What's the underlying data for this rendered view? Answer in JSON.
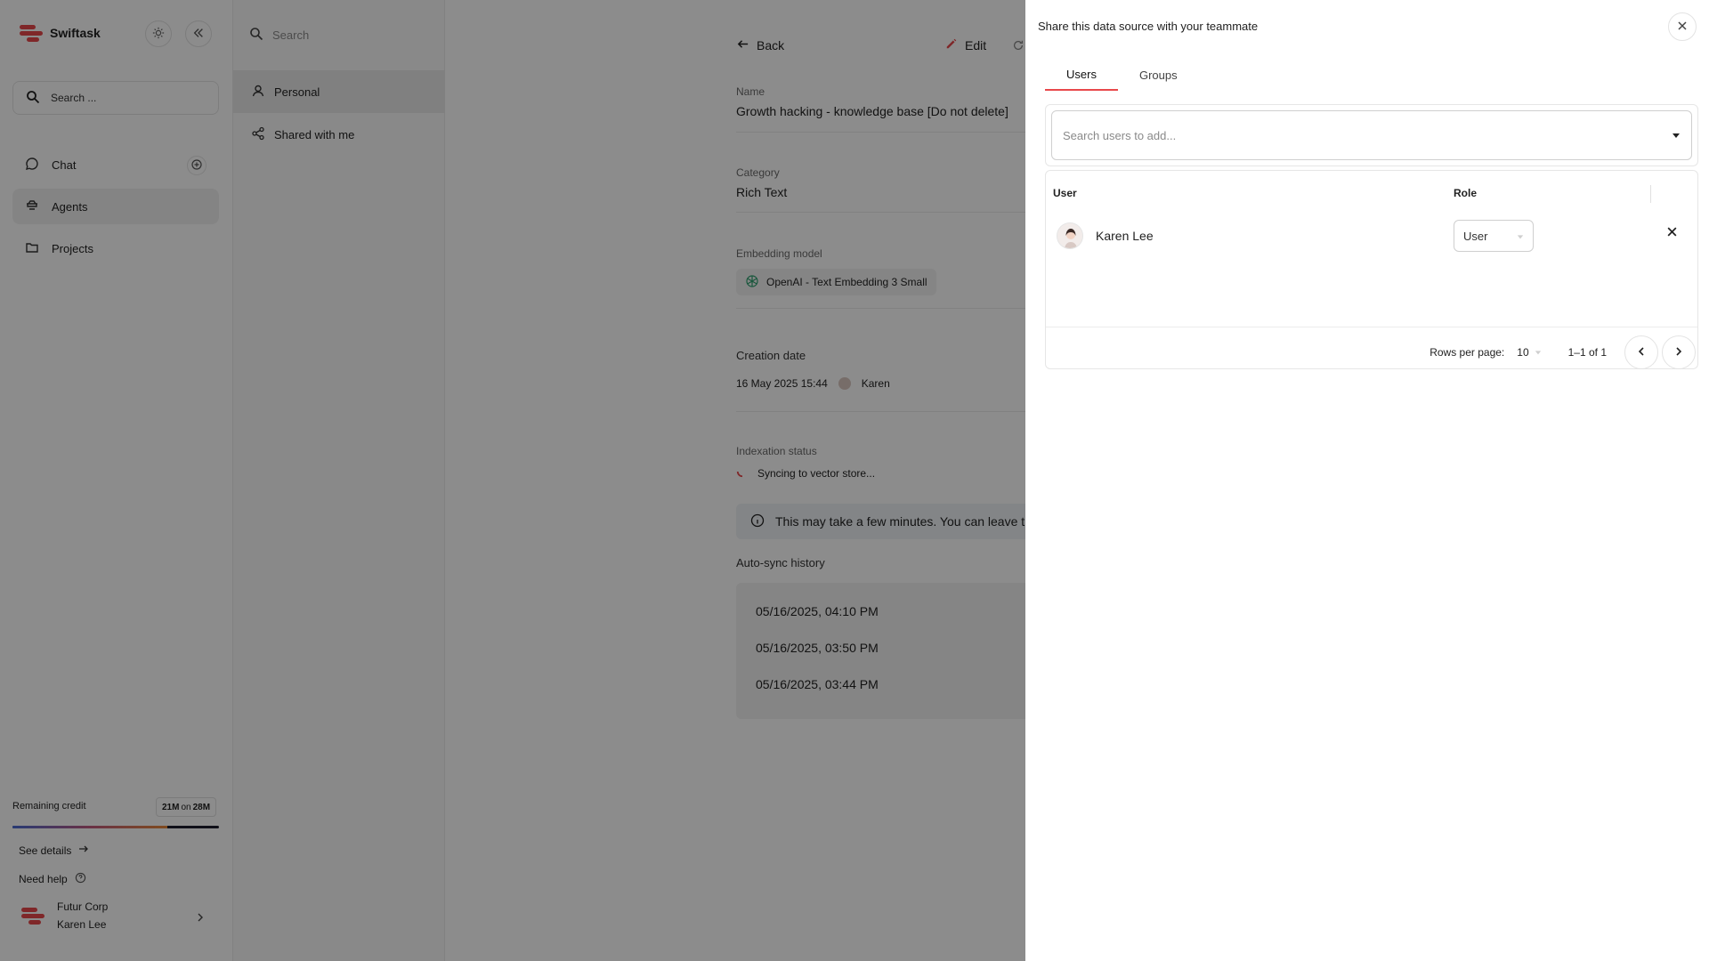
{
  "app": {
    "brand_name": "Swiftask",
    "brand_color": "#e8484b"
  },
  "sidebar": {
    "search_label": "Search ...",
    "nav": [
      {
        "label": "Chat",
        "icon": "chat-bubble-icon"
      },
      {
        "label": "Agents",
        "icon": "agents-icon"
      },
      {
        "label": "Projects",
        "icon": "folder-icon"
      }
    ],
    "credit": {
      "label": "Remaining credit",
      "remaining": "21M",
      "on": "on",
      "total": "28M",
      "used_fraction": 0.75
    },
    "see_details": "See details",
    "need_help": "Need help",
    "org_name": "Futur Corp",
    "user_name": "Karen Lee"
  },
  "column2": {
    "search_placeholder": "Search",
    "items": [
      {
        "label": "Personal",
        "icon": "person-icon"
      },
      {
        "label": "Shared with me",
        "icon": "share-icon"
      }
    ]
  },
  "main": {
    "back_label": "Back",
    "edit_label": "Edit",
    "name_label": "Name",
    "name_value": "Growth hacking - knowledge base [Do not delete]",
    "category_label": "Category",
    "category_value": "Rich Text",
    "embedding_label": "Embedding model",
    "embedding_value": "OpenAI - Text Embedding 3 Small",
    "creation_label": "Creation date",
    "creation_date": "16 May 2025 15:44",
    "creator": "Karen",
    "indexation_label": "Indexation status",
    "indexation_value": "Syncing to vector store...",
    "info_text": "This may take a few minutes. You can leave this",
    "history_label": "Auto-sync history",
    "history": [
      "05/16/2025, 04:10 PM",
      "05/16/2025, 03:50 PM",
      "05/16/2025, 03:44 PM"
    ]
  },
  "drawer": {
    "title": "Share this data source with your teammate",
    "tabs": [
      "Users",
      "Groups"
    ],
    "search_placeholder": "Search users to add...",
    "columns": {
      "user": "User",
      "role": "Role"
    },
    "rows": [
      {
        "name": "Karen Lee",
        "role": "User"
      }
    ],
    "rows_per_page_label": "Rows per page:",
    "rows_per_page": "10",
    "range": "1–1 of 1"
  }
}
